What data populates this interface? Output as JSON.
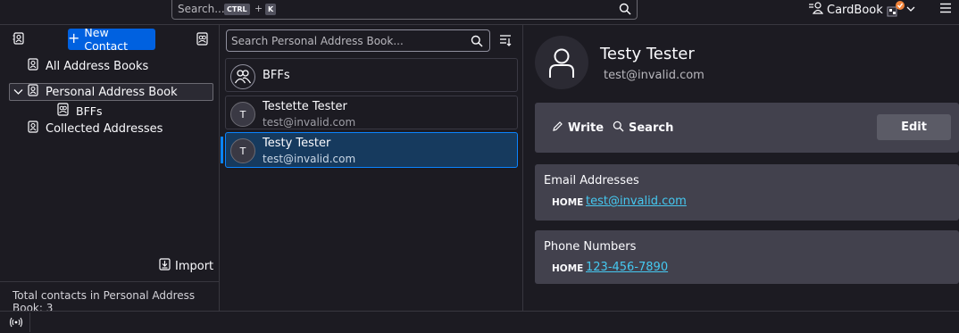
{
  "topbar": {
    "search_placeholder": "Search...",
    "shortcut_ctrl": "CTRL",
    "shortcut_plus": "+",
    "shortcut_key": "K",
    "cardbook_label": "CardBook"
  },
  "left_pane": {
    "new_contact_label": "New Contact",
    "tree": [
      {
        "label": "All Address Books"
      },
      {
        "label": "Personal Address Book"
      },
      {
        "label": "BFFs"
      },
      {
        "label": "Collected Addresses"
      }
    ],
    "import_label": "Import",
    "total_text": "Total contacts in Personal Address Book: 3"
  },
  "middle_pane": {
    "search_placeholder": "Search Personal Address Book...",
    "cards": [
      {
        "name": "BFFs",
        "email": "",
        "initial": ""
      },
      {
        "name": "Testette Tester",
        "email": "test@invalid.com",
        "initial": "T"
      },
      {
        "name": "Testy Tester",
        "email": "test@invalid.com",
        "initial": "T"
      }
    ]
  },
  "contact": {
    "name": "Testy Tester",
    "email": "test@invalid.com",
    "actions": {
      "write": "Write",
      "search": "Search",
      "edit": "Edit"
    },
    "email_section": {
      "title": "Email Addresses",
      "type": "HOME",
      "value": "test@invalid.com"
    },
    "phone_section": {
      "title": "Phone Numbers",
      "type": "HOME",
      "value": "123-456-7890"
    }
  },
  "colors": {
    "accent": "#0061e0",
    "selection": "#163a5e",
    "link": "#45c8f0",
    "panel": "#42414d",
    "background": "#1c1b22"
  }
}
